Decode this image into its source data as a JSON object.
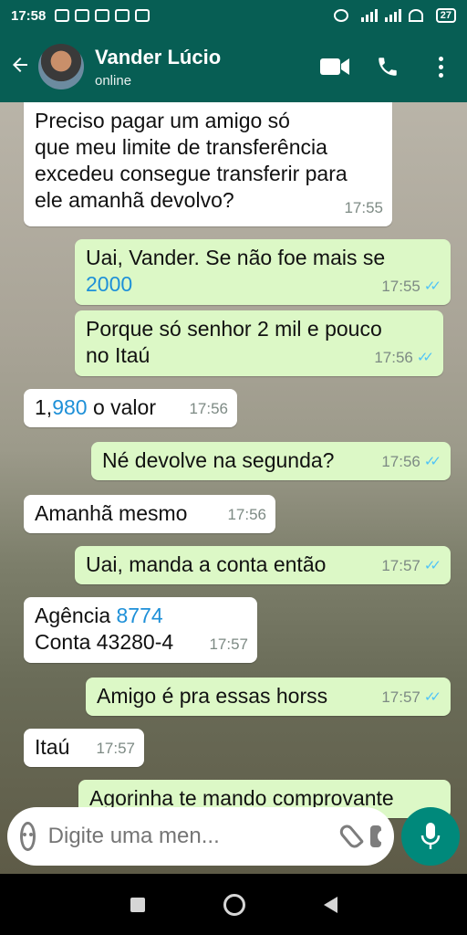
{
  "status_bar": {
    "time": "17:58",
    "battery": "27"
  },
  "header": {
    "contact_name": "Vander Lúcio",
    "contact_status": "online"
  },
  "messages": [
    {
      "dir": "in",
      "lines": [
        "Preciso pagar um amigo só",
        "que meu limite de transferência",
        "excedeu consegue transferir para",
        "ele amanhã devolvo?"
      ],
      "time": "17:55"
    },
    {
      "dir": "out",
      "line1": "Uai, Vander. Se não foe mais se",
      "line2": "2000",
      "time": "17:55"
    },
    {
      "dir": "out",
      "lines": [
        "Porque só senhor 2 mil e pouco",
        "no Itaú"
      ],
      "time": "17:56"
    },
    {
      "dir": "in",
      "text_prefix": "1,",
      "text_link": "980",
      "text_suffix": " o valor",
      "time": "17:56"
    },
    {
      "dir": "out",
      "text": "Né devolve na segunda?",
      "time": "17:56"
    },
    {
      "dir": "in",
      "text": "Amanhã mesmo",
      "time": "17:56"
    },
    {
      "dir": "out",
      "text": "Uai, manda a conta então",
      "time": "17:57"
    },
    {
      "dir": "in",
      "line1_prefix": "Agência ",
      "line1_link": "8774",
      "line2": "Conta 43280-4",
      "time": "17:57"
    },
    {
      "dir": "out",
      "text": "Amigo é pra essas horss",
      "time": "17:57"
    },
    {
      "dir": "in",
      "text": "Itaú",
      "time": "17:57"
    },
    {
      "dir": "out",
      "text": "Agorinha te mando comprovante"
    }
  ],
  "input": {
    "placeholder": "Digite uma men..."
  },
  "icons": [
    "back-arrow-icon",
    "video-call-icon",
    "phone-icon",
    "menu-dots-icon",
    "emoji-icon",
    "attach-icon",
    "camera-icon",
    "mic-icon"
  ],
  "colors": {
    "header": "#075e54",
    "outgoing": "#dcf8c6",
    "incoming": "#ffffff",
    "link": "#1e90d8",
    "mic": "#00897b"
  }
}
